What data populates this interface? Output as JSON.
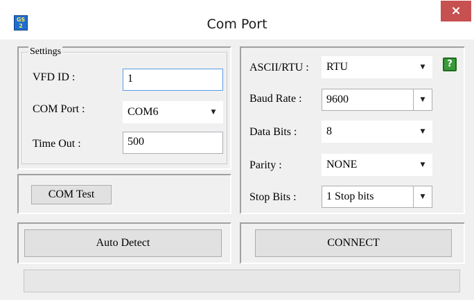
{
  "window": {
    "title": "Com Port",
    "close_glyph": "×",
    "icon_text": "GS 2"
  },
  "settings": {
    "group_title": "Settings",
    "vfd_id_label": "VFD ID :",
    "vfd_id_value": "1",
    "com_port_label": "COM Port :",
    "com_port_value": "COM6",
    "timeout_label": "Time Out :",
    "timeout_value": "500"
  },
  "com_test_button": "COM Test",
  "serial": {
    "mode_label": "ASCII/RTU :",
    "mode_value": "RTU",
    "baud_label": "Baud Rate :",
    "baud_value": "9600",
    "data_bits_label": "Data Bits :",
    "data_bits_value": "8",
    "parity_label": "Parity :",
    "parity_value": "NONE",
    "stop_bits_label": "Stop Bits :",
    "stop_bits_value": "1 Stop bits"
  },
  "help_glyph": "?",
  "auto_detect_button": "Auto Detect",
  "connect_button": "CONNECT",
  "dropdown_arrow": "▼",
  "icons": {
    "app": "app-icon",
    "close": "close-icon",
    "help": "help-icon",
    "dropdown": "chevron-down-icon"
  },
  "colors": {
    "close_button": "#c75050",
    "focus_border": "#569de5",
    "help_icon": "#3a9a3a"
  }
}
